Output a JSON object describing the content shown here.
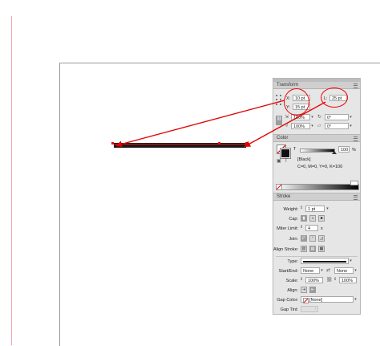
{
  "transform": {
    "title": "Transform",
    "x_label": "X:",
    "x_value": "10 pt",
    "y_label": "Y:",
    "y_value": "15 pt",
    "l_label": "L:",
    "l_value": "25 pt",
    "scale_x": "100%",
    "scale_y": "100%",
    "rotate": "0°",
    "shear": "0°"
  },
  "color": {
    "title": "Color",
    "tint_label": "T",
    "tint_value": "100",
    "percent": "%",
    "swatch_name": "[Black]",
    "formula": "C=0, M=0, Y=0, K=100"
  },
  "stroke": {
    "title": "Stroke",
    "weight_label": "Weight:",
    "weight_value": "1 pt",
    "cap_label": "Cap:",
    "miter_label": "Miter Limit:",
    "miter_value": "4",
    "miter_unit": "x",
    "join_label": "Join:",
    "align_label": "Align Stroke:",
    "type_label": "Type:",
    "startend_label": "Start/End:",
    "start_value": "None",
    "end_value": "None",
    "scale_label": "Scale:",
    "scale_start": "100%",
    "scale_end": "100%",
    "align2_label": "Align:",
    "gap_color_label": "Gap Color:",
    "gap_color_value": "[None]",
    "gap_tint_label": "Gap Tint:"
  },
  "colors": {
    "accent_red": "#e00000",
    "stroke_black": "#1a1a1a"
  }
}
